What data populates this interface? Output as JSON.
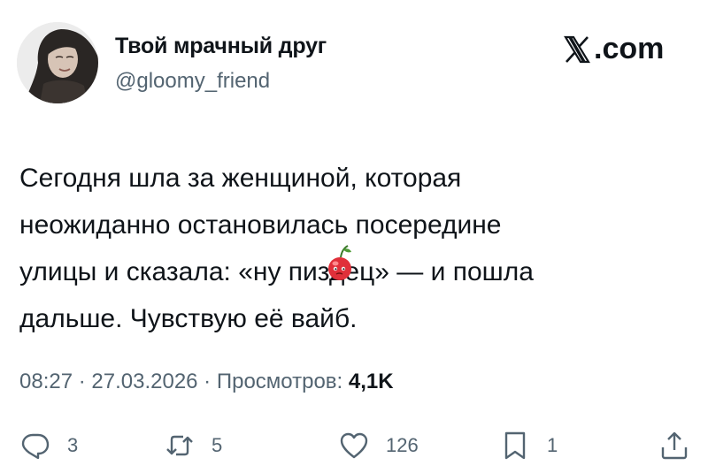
{
  "author": {
    "display_name": "Твой мрачный друг",
    "handle": "@gloomy_friend"
  },
  "brand": {
    "x_symbol": "𝕏",
    "suffix": ".com"
  },
  "tweet": {
    "lines": [
      "Сегодня шла за женщиной, которая",
      "неожиданно остановилась посередине"
    ],
    "line3_before": "улицы и сказала: «ну пиз",
    "line3_censored": "д",
    "line3_after": "ец» — и пошла",
    "line4": "дальше. Чувствую её вайб."
  },
  "meta": {
    "time": "08:27",
    "sep1": " · ",
    "date": "27.03.2026",
    "sep2": " · ",
    "views_label": "Просмотров: ",
    "views_count": "4,1K"
  },
  "actions": {
    "replies": "3",
    "reposts": "5",
    "likes": "126",
    "bookmarks": "1"
  },
  "icons": {
    "reply": "reply-icon",
    "repost": "repost-icon",
    "like": "heart-icon",
    "bookmark": "bookmark-icon",
    "share": "share-icon",
    "censor": "cherry-icon"
  },
  "colors": {
    "text": "#0f1419",
    "secondary": "#536471",
    "cherry": "#e0303a"
  }
}
